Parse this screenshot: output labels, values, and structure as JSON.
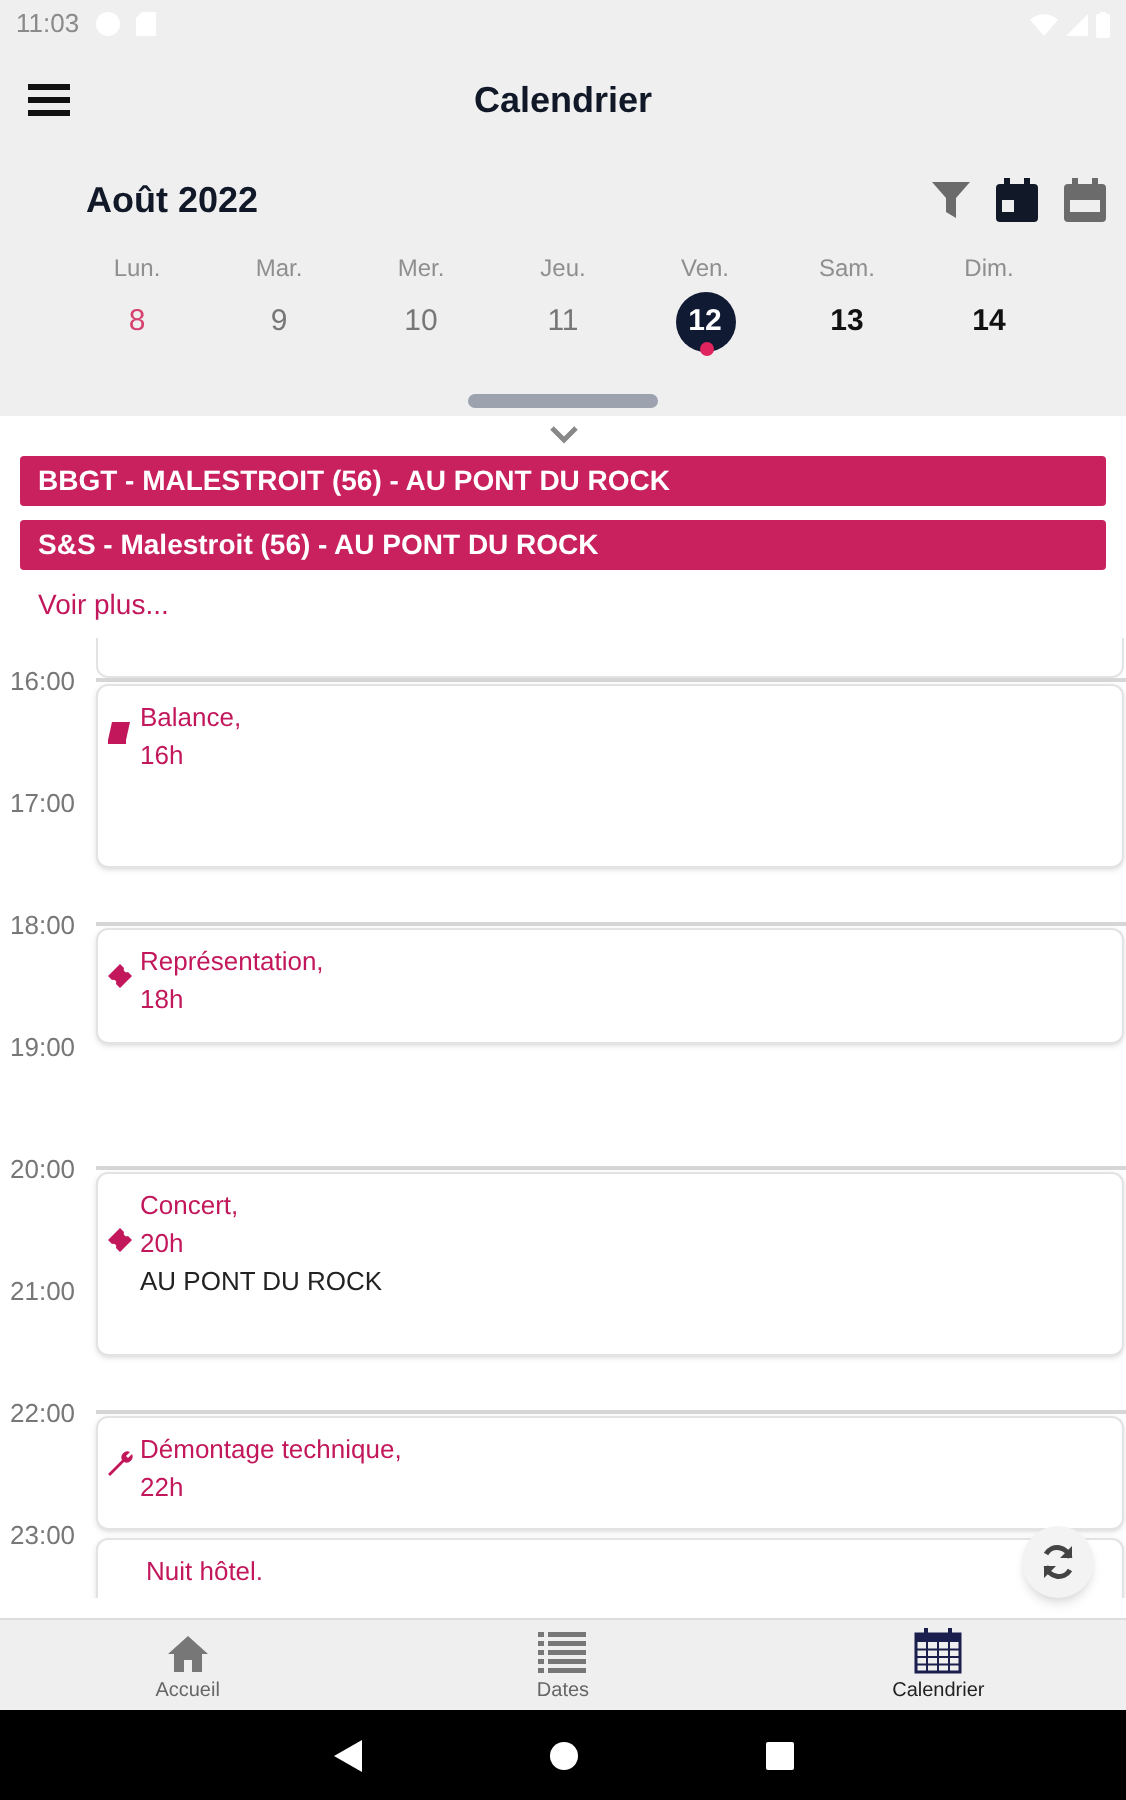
{
  "status_bar": {
    "time": "11:03"
  },
  "app_bar": {
    "title": "Calendrier"
  },
  "month": {
    "label": "Août 2022"
  },
  "view_buttons": [
    {
      "kind": "filter",
      "selected": false
    },
    {
      "kind": "day",
      "selected": true
    },
    {
      "kind": "week",
      "selected": false
    }
  ],
  "days": [
    {
      "name": "Lun.",
      "number": "8",
      "kind": "today",
      "selected": false,
      "has_events": false
    },
    {
      "name": "Mar.",
      "number": "9",
      "kind": "past",
      "selected": false,
      "has_events": false
    },
    {
      "name": "Mer.",
      "number": "10",
      "kind": "past",
      "selected": false,
      "has_events": false
    },
    {
      "name": "Jeu.",
      "number": "11",
      "kind": "past",
      "selected": false,
      "has_events": false
    },
    {
      "name": "Ven.",
      "number": "12",
      "kind": "future",
      "selected": true,
      "has_events": true
    },
    {
      "name": "Sam.",
      "number": "13",
      "kind": "future",
      "selected": false,
      "has_events": false
    },
    {
      "name": "Dim.",
      "number": "14",
      "kind": "future",
      "selected": false,
      "has_events": false
    }
  ],
  "all_day_events": [
    {
      "title": "BBGT - MALESTROIT (56) - AU PONT DU ROCK",
      "color": "#c8215d"
    },
    {
      "title": "S&S - Malestroit (56) - AU PONT DU ROCK",
      "color": "#c8215d"
    }
  ],
  "see_more": "Voir plus...",
  "hours": [
    "16:00",
    "17:00",
    "18:00",
    "19:00",
    "20:00",
    "21:00",
    "22:00",
    "23:00"
  ],
  "events": [
    {
      "kind": "balance",
      "title": "Balance,",
      "time": "16h"
    },
    {
      "kind": "ticket",
      "title": "Représentation,",
      "time": "18h"
    },
    {
      "kind": "ticket",
      "title": "Concert,",
      "time": "20h",
      "place": "AU PONT DU ROCK"
    },
    {
      "kind": "tool",
      "title": "Démontage technique,",
      "time": "22h"
    },
    {
      "kind": "none",
      "title": "Nuit hôtel."
    }
  ],
  "bottom_nav": [
    {
      "kind": "home",
      "label": "Accueil",
      "selected": false
    },
    {
      "kind": "list",
      "label": "Dates",
      "selected": false
    },
    {
      "kind": "calendar",
      "label": "Calendrier",
      "selected": true
    }
  ]
}
